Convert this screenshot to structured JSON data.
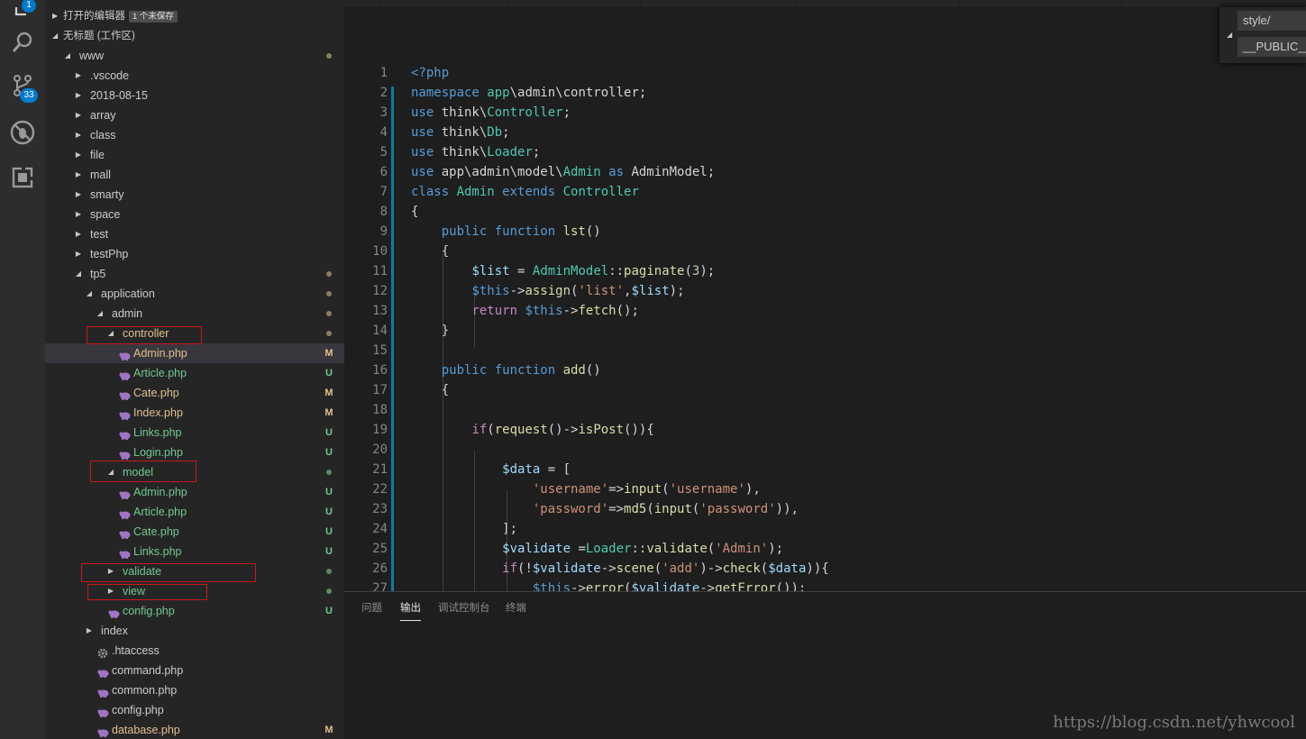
{
  "activity_bar": {
    "items": [
      {
        "name": "explorer-icon",
        "badge": "1"
      },
      {
        "name": "search-icon",
        "badge": ""
      },
      {
        "name": "source-control-icon",
        "badge": "33"
      },
      {
        "name": "debug-icon",
        "badge": ""
      },
      {
        "name": "extensions-icon",
        "badge": ""
      }
    ]
  },
  "sidebar": {
    "open_editors": {
      "label": "打开的编辑器",
      "unsaved": "1 个未保存"
    },
    "workspace": {
      "label": "无标题 (工作区)"
    },
    "tree": [
      {
        "text": "www",
        "twisty": "open",
        "status": "dot"
      },
      {
        "text": ".vscode",
        "twisty": "closed",
        "status": ""
      },
      {
        "text": "2018-08-15",
        "twisty": "closed",
        "status": ""
      },
      {
        "text": "array",
        "twisty": "closed",
        "status": ""
      },
      {
        "text": "class",
        "twisty": "closed",
        "status": ""
      },
      {
        "text": "file",
        "twisty": "closed",
        "status": ""
      },
      {
        "text": "mall",
        "twisty": "closed",
        "status": ""
      },
      {
        "text": "smarty",
        "twisty": "closed",
        "status": ""
      },
      {
        "text": "space",
        "twisty": "closed",
        "status": ""
      },
      {
        "text": "test",
        "twisty": "closed",
        "status": ""
      },
      {
        "text": "testPhp",
        "twisty": "closed",
        "status": ""
      },
      {
        "text": "tp5",
        "twisty": "open",
        "status": "dot"
      },
      {
        "text": "application",
        "twisty": "open",
        "status": "dot"
      },
      {
        "text": "admin",
        "twisty": "open",
        "status": "dot"
      },
      {
        "text": "controller",
        "twisty": "open",
        "status": "dot"
      },
      {
        "text": "Admin.php",
        "file": "php",
        "status": "M"
      },
      {
        "text": "Article.php",
        "file": "php",
        "status": "U"
      },
      {
        "text": "Cate.php",
        "file": "php",
        "status": "M"
      },
      {
        "text": "Index.php",
        "file": "php",
        "status": "M"
      },
      {
        "text": "Links.php",
        "file": "php",
        "status": "U"
      },
      {
        "text": "Login.php",
        "file": "php",
        "status": "U"
      },
      {
        "text": "model",
        "twisty": "open",
        "status": "dot-green"
      },
      {
        "text": "Admin.php",
        "file": "php",
        "status": "U"
      },
      {
        "text": "Article.php",
        "file": "php",
        "status": "U"
      },
      {
        "text": "Cate.php",
        "file": "php",
        "status": "U"
      },
      {
        "text": "Links.php",
        "file": "php",
        "status": "U"
      },
      {
        "text": "validate",
        "twisty": "closed",
        "status": "dot-green"
      },
      {
        "text": "view",
        "twisty": "closed",
        "status": "dot-green"
      },
      {
        "text": "config.php",
        "file": "php",
        "status": "U"
      },
      {
        "text": "index",
        "twisty": "closed",
        "status": ""
      },
      {
        "text": ".htaccess",
        "file": "gear",
        "status": ""
      },
      {
        "text": "command.php",
        "file": "php",
        "status": ""
      },
      {
        "text": "common.php",
        "file": "php",
        "status": ""
      },
      {
        "text": "config.php",
        "file": "php",
        "status": ""
      },
      {
        "text": "database.php",
        "file": "php",
        "status": "M"
      }
    ]
  },
  "editor": {
    "lines": [
      [
        [
          "kw",
          "<?php"
        ]
      ],
      [
        [
          "kw",
          "namespace "
        ],
        [
          "ty",
          "app"
        ],
        [
          "",
          "\\admin\\controller;"
        ]
      ],
      [
        [
          "kw",
          "use "
        ],
        [
          "",
          "think\\"
        ],
        [
          "ty",
          "Controller"
        ],
        [
          "",
          ";"
        ]
      ],
      [
        [
          "kw",
          "use "
        ],
        [
          "",
          "think\\"
        ],
        [
          "ty",
          "Db"
        ],
        [
          "",
          ";"
        ]
      ],
      [
        [
          "kw",
          "use "
        ],
        [
          "",
          "think\\"
        ],
        [
          "ty",
          "Loader"
        ],
        [
          "",
          ";"
        ]
      ],
      [
        [
          "kw",
          "use "
        ],
        [
          "",
          "app\\admin\\model\\"
        ],
        [
          "ty",
          "Admin"
        ],
        [
          "kw",
          " as "
        ],
        [
          "",
          "AdminModel;"
        ]
      ],
      [
        [
          "kw",
          "class "
        ],
        [
          "ty",
          "Admin "
        ],
        [
          "kw",
          "extends "
        ],
        [
          "ty",
          "Controller"
        ]
      ],
      [
        [
          "",
          "{"
        ]
      ],
      [
        [
          "",
          "    "
        ],
        [
          "kw",
          "public function "
        ],
        [
          "fn",
          "lst"
        ],
        [
          "",
          "()"
        ]
      ],
      [
        [
          "",
          "    {"
        ]
      ],
      [
        [
          "",
          "        "
        ],
        [
          "var",
          "$list"
        ],
        [
          "",
          " = "
        ],
        [
          "ty",
          "AdminModel"
        ],
        [
          "",
          "::"
        ],
        [
          "fn",
          "paginate"
        ],
        [
          "",
          "("
        ],
        [
          "num",
          "3"
        ],
        [
          "",
          ");"
        ]
      ],
      [
        [
          "",
          "        "
        ],
        [
          "kw",
          "$this"
        ],
        [
          "",
          "->"
        ],
        [
          "fn",
          "assign"
        ],
        [
          "",
          "("
        ],
        [
          "str",
          "'list'"
        ],
        [
          "",
          ","
        ],
        [
          "var",
          "$list"
        ],
        [
          "",
          ");"
        ]
      ],
      [
        [
          "",
          "        "
        ],
        [
          "kc",
          "return "
        ],
        [
          "kw",
          "$this"
        ],
        [
          "",
          "->"
        ],
        [
          "fn",
          "fetch"
        ],
        [
          "",
          "();"
        ]
      ],
      [
        [
          "",
          "    }"
        ]
      ],
      [
        [
          "",
          ""
        ]
      ],
      [
        [
          "",
          "    "
        ],
        [
          "kw",
          "public function "
        ],
        [
          "fn",
          "add"
        ],
        [
          "",
          "()"
        ]
      ],
      [
        [
          "",
          "    {"
        ]
      ],
      [
        [
          "",
          ""
        ]
      ],
      [
        [
          "",
          "        "
        ],
        [
          "kc",
          "if"
        ],
        [
          "",
          "("
        ],
        [
          "fn",
          "request"
        ],
        [
          "",
          "()->"
        ],
        [
          "fn",
          "isPost"
        ],
        [
          "",
          "()){"
        ]
      ],
      [
        [
          "",
          ""
        ]
      ],
      [
        [
          "",
          "            "
        ],
        [
          "var",
          "$data"
        ],
        [
          "",
          " = ["
        ]
      ],
      [
        [
          "",
          "                "
        ],
        [
          "str",
          "'username'"
        ],
        [
          "",
          "=>"
        ],
        [
          "fn",
          "input"
        ],
        [
          "",
          "("
        ],
        [
          "str",
          "'username'"
        ],
        [
          "",
          "),"
        ]
      ],
      [
        [
          "",
          "                "
        ],
        [
          "str",
          "'password'"
        ],
        [
          "",
          "=>"
        ],
        [
          "fn",
          "md5"
        ],
        [
          "",
          "("
        ],
        [
          "fn",
          "input"
        ],
        [
          "",
          "("
        ],
        [
          "str",
          "'password'"
        ],
        [
          "",
          ")),"
        ]
      ],
      [
        [
          "",
          "            ];"
        ]
      ],
      [
        [
          "",
          "            "
        ],
        [
          "var",
          "$validate"
        ],
        [
          "",
          " ="
        ],
        [
          "ty",
          "Loader"
        ],
        [
          "",
          "::"
        ],
        [
          "fn",
          "validate"
        ],
        [
          "",
          "("
        ],
        [
          "str",
          "'Admin'"
        ],
        [
          "",
          ");"
        ]
      ],
      [
        [
          "",
          "            "
        ],
        [
          "kc",
          "if"
        ],
        [
          "",
          "(!"
        ],
        [
          "var",
          "$validate"
        ],
        [
          "",
          "->"
        ],
        [
          "fn",
          "scene"
        ],
        [
          "",
          "("
        ],
        [
          "str",
          "'add'"
        ],
        [
          "",
          ")->"
        ],
        [
          "fn",
          "check"
        ],
        [
          "",
          "("
        ],
        [
          "var",
          "$data"
        ],
        [
          "",
          "))"
        ],
        [
          "",
          "{"
        ]
      ],
      [
        [
          "",
          "                "
        ],
        [
          "kw",
          "$this"
        ],
        [
          "",
          "->"
        ],
        [
          "fn",
          "error"
        ],
        [
          "",
          "("
        ],
        [
          "var",
          "$validate"
        ],
        [
          "",
          "->"
        ],
        [
          "fn",
          "getError"
        ],
        [
          "",
          "());"
        ]
      ]
    ],
    "line_numbers": [
      "1",
      "2",
      "3",
      "4",
      "5",
      "6",
      "7",
      "8",
      "9",
      "10",
      "11",
      "12",
      "13",
      "14",
      "15",
      "16",
      "17",
      "18",
      "19",
      "20",
      "21",
      "22",
      "23",
      "24",
      "25",
      "26",
      "27"
    ]
  },
  "suggest_widget": {
    "item1": "style/",
    "item2": "__PUBLIC__/s"
  },
  "panel": {
    "tabs": [
      "问题",
      "输出",
      "调试控制台",
      "终端"
    ],
    "active_tab": "输出"
  },
  "watermark": "https://blog.csdn.net/yhwcool",
  "colors": {
    "accent": "#007acc",
    "modified": "#e2c08d",
    "untracked": "#73c991",
    "highlight_box": "#c8191b"
  }
}
